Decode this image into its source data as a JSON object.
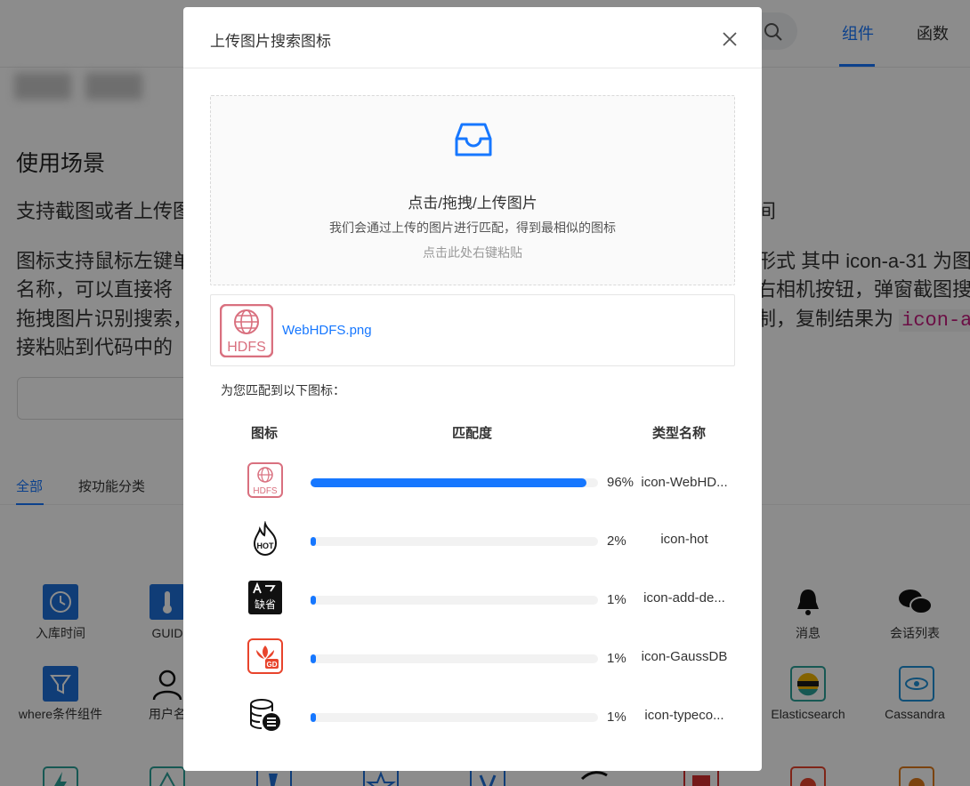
{
  "background": {
    "nav_tabs": [
      {
        "label": "组件"
      },
      {
        "label": "函数"
      }
    ],
    "section_title": "使用场景",
    "lines": [
      "支持截图或者上传图",
      "间",
      "图标支持鼠标左键单",
      "形式 其中 icon-a-31 为图",
      "名称，可以直接将",
      "右相机按钮，弹窗截图搜",
      "拖拽图片识别搜索，",
      "制，复制结果为",
      "icon-a",
      "接粘贴到代码中的"
    ],
    "filter_tabs": [
      "全部",
      "按功能分类"
    ],
    "grid_labels": {
      "ruku": "入库时间",
      "guid": "GUID",
      "xiaoxi": "消息",
      "huihua": "会话列表",
      "where": "where条件组件",
      "yonghu": "用户名",
      "es": "Elasticsearch",
      "cassandra": "Cassandra"
    }
  },
  "modal": {
    "title": "上传图片搜索图标",
    "dropzone": {
      "main": "点击/拖拽/上传图片",
      "sub": "我们会通过上传的图片进行匹配，得到最相似的图标",
      "paste": "点击此处右键粘贴"
    },
    "file": {
      "name": "WebHDFS.png",
      "thumb_text": "HDFS"
    },
    "match_caption": "为您匹配到以下图标：",
    "columns": {
      "icon": "图标",
      "match": "匹配度",
      "name": "类型名称"
    },
    "results": [
      {
        "icon": "hdfs-icon",
        "percent": 96,
        "percent_label": "96%",
        "name": "icon-WebHD...",
        "icon_text": "HDFS"
      },
      {
        "icon": "hot-flame-icon",
        "percent": 2,
        "percent_label": "2%",
        "name": "icon-hot",
        "icon_text": "HOT"
      },
      {
        "icon": "default-value-icon",
        "percent": 1,
        "percent_label": "1%",
        "name": "icon-add-de...",
        "icon_text": "缺省"
      },
      {
        "icon": "gaussdb-icon",
        "percent": 1,
        "percent_label": "1%",
        "name": "icon-GaussDB",
        "icon_text": "GD"
      },
      {
        "icon": "database-list-icon",
        "percent": 1,
        "percent_label": "1%",
        "name": "icon-typeco..."
      }
    ]
  },
  "colors": {
    "accent": "#1677ff",
    "hdfs_pink": "#d9707f",
    "gauss_red": "#e8442c"
  }
}
